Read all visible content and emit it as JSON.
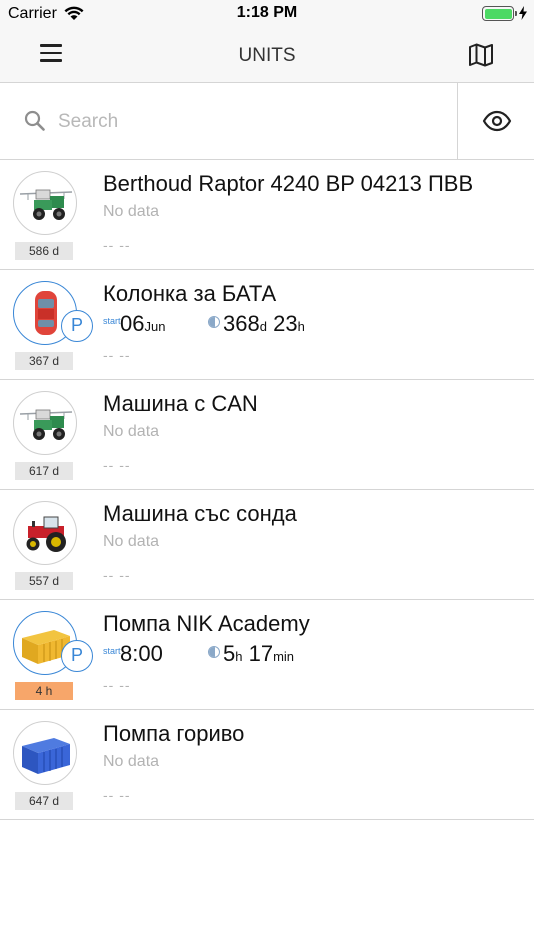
{
  "status_bar": {
    "carrier": "Carrier",
    "time": "1:18 PM",
    "battery_color": "#4cd964"
  },
  "nav": {
    "title": "UNITS",
    "menu_icon": "hamburger-icon",
    "map_icon": "map-icon"
  },
  "search": {
    "placeholder": "Search",
    "value": "",
    "visibility_icon": "eye-icon"
  },
  "colors": {
    "accent": "#3a87d6",
    "stale_badge": "#f7a66a",
    "muted_text": "#b3b3b3"
  },
  "units": [
    {
      "name": "Berthoud Raptor 4240 BP 04213 ПВВ",
      "status": "No data",
      "last": "-- --",
      "age": "586 d",
      "icon": "sprayer-icon"
    },
    {
      "name": "Колонка за БАТА",
      "start_label": "start",
      "start_value": "06",
      "start_unit": "Jun",
      "duration_1": "368",
      "duration_1_unit": "d",
      "duration_2": "23",
      "duration_2_unit": "h",
      "last": "-- --",
      "age": "367 d",
      "icon": "car-icon",
      "parking": "P"
    },
    {
      "name": "Машина с CAN",
      "status": "No data",
      "last": "-- --",
      "age": "617 d",
      "icon": "sprayer-icon"
    },
    {
      "name": "Машина със сонда",
      "status": "No data",
      "last": "-- --",
      "age": "557 d",
      "icon": "tractor-icon"
    },
    {
      "name": "Помпа NIK Academy",
      "start_label": "start",
      "start_value": "8:00",
      "start_unit": "",
      "duration_1": "5",
      "duration_1_unit": "h",
      "duration_2": "17",
      "duration_2_unit": "min",
      "last": "-- --",
      "age": "4 h",
      "icon": "container-yellow-icon",
      "parking": "P"
    },
    {
      "name": "Помпа гориво",
      "status": "No data",
      "last": "-- --",
      "age": "647 d",
      "icon": "container-blue-icon"
    }
  ]
}
